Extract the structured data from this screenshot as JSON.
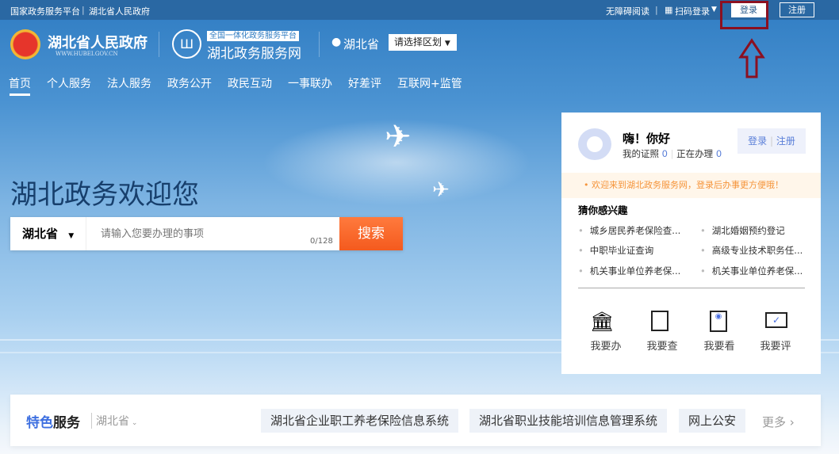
{
  "topbar": {
    "left1": "国家政务服务平台",
    "left2": "湖北省人民政府",
    "accessible": "无障碍阅读",
    "qr_login": "扫码登录",
    "login": "登录",
    "register": "注册"
  },
  "header": {
    "gov_name": "湖北省人民政府",
    "gov_url": "WWW.HUBEI.GOV.CN",
    "platform_badge": "全国一体化政务服务平台",
    "site_name": "湖北政务服务网",
    "location": "湖北省",
    "region_select": "请选择区划"
  },
  "nav": [
    "首页",
    "个人服务",
    "法人服务",
    "政务公开",
    "政民互动",
    "一事联办",
    "好差评",
    "互联网+监管"
  ],
  "hero": {
    "title": "湖北政务欢迎您",
    "region": "湖北省",
    "placeholder": "请输入您要办理的事项",
    "counter": "0/128",
    "search": "搜索"
  },
  "card": {
    "greeting": "嗨！你好",
    "licenses_label": "我的证照",
    "licenses": "0",
    "processing_label": "正在办理",
    "processing": "0",
    "login": "登录",
    "register": "注册",
    "notice": "欢迎来到湖北政务服务网，登录后办事更方便哦！",
    "interest_title": "猜你感兴趣",
    "interests": [
      "城乡居民养老保险查...",
      "湖北婚姻预约登记",
      "中职毕业证查询",
      "高级专业技术职务任...",
      "机关事业单位养老保...",
      "机关事业单位养老保..."
    ],
    "quick": [
      "我要办",
      "我要查",
      "我要看",
      "我要评"
    ]
  },
  "featured": {
    "title_a": "特色",
    "title_b": "服务",
    "region": "湖北省",
    "items": [
      "湖北省企业职工养老保险信息系统",
      "湖北省职业技能培训信息管理系统",
      "网上公安"
    ],
    "more": "更多"
  }
}
